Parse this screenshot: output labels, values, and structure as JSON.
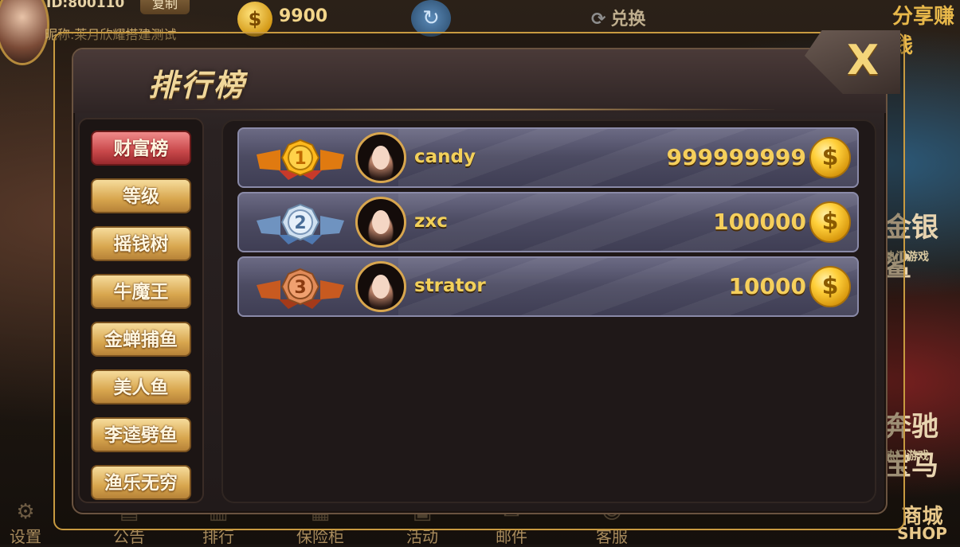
{
  "top_bar": {
    "user_id": "ID:800110",
    "copy_button": "复制",
    "nickname": "昵称:莱月欣耀搭建测试",
    "coins": "9900",
    "exchange_label": "兑换",
    "share_label": "分享赚钱"
  },
  "side_games": [
    "金银鲨",
    "奔驰宝马"
  ],
  "side_game_sub": [
    "热门游戏",
    "热门游戏"
  ],
  "bottom_bar": [
    "设置",
    "公告",
    "排行",
    "保险柜",
    "活动",
    "邮件",
    "客服",
    "商城"
  ],
  "shop_label": "SHOP",
  "modal": {
    "title": "排行榜",
    "close_label": "X"
  },
  "nav": {
    "items": [
      "财富榜",
      "等级",
      "摇钱树",
      "牛魔王",
      "金蝉捕鱼",
      "美人鱼",
      "李逵劈鱼",
      "渔乐无穷"
    ],
    "active_index": 0
  },
  "leaderboard": [
    {
      "rank": "1",
      "name": "candy",
      "score": "999999999",
      "badge": "gold-medal-icon"
    },
    {
      "rank": "2",
      "name": "zxc",
      "score": "100000",
      "badge": "silver-medal-icon"
    },
    {
      "rank": "3",
      "name": "strator",
      "score": "10000",
      "badge": "bronze-medal-icon"
    }
  ],
  "colors": {
    "gold": "#f2d05a",
    "active_tab": "#c8484a",
    "inactive_tab": "#d8a64e",
    "row_bg": "#4c4b62",
    "gold_medal": "#f0a020",
    "silver_medal": "#9ab4d0",
    "bronze_medal": "#c87440"
  },
  "coin_symbol": "$"
}
